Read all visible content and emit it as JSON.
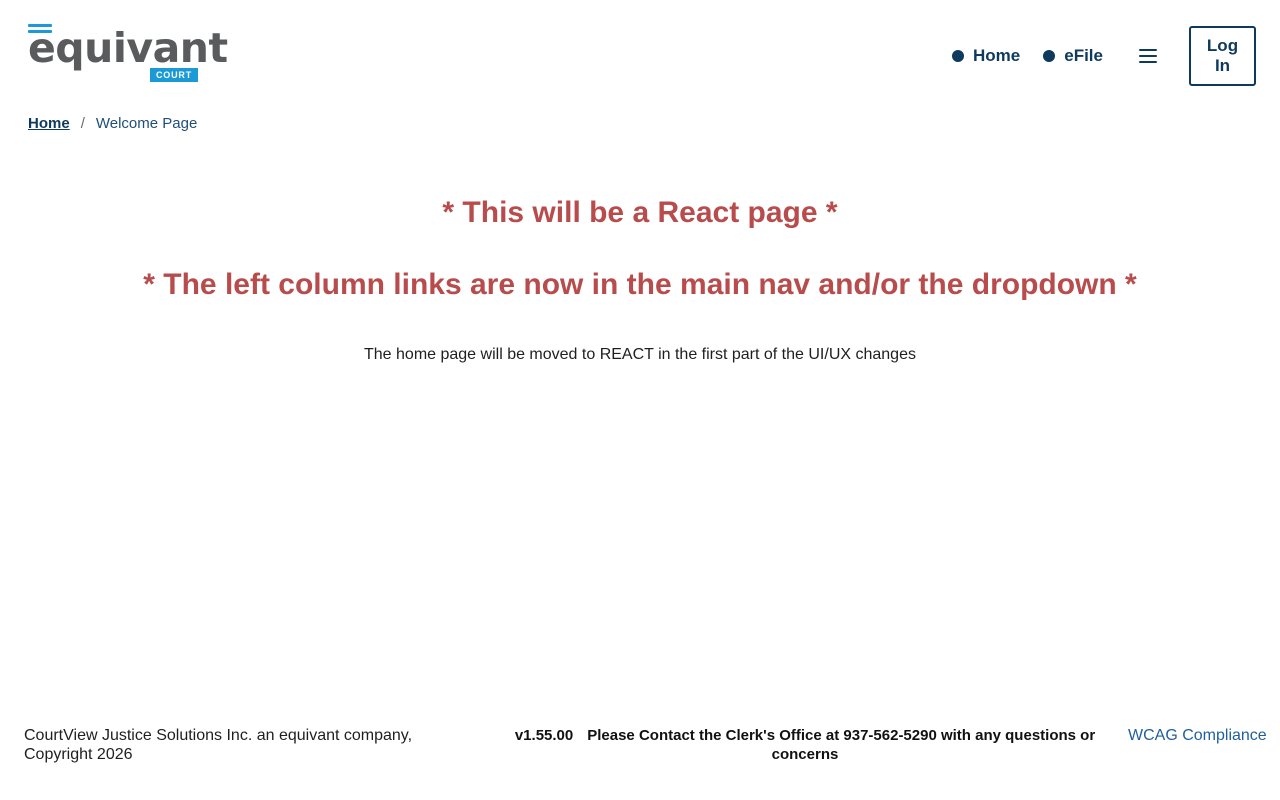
{
  "logo": {
    "wordmark": "equivant",
    "badge": "COURT",
    "accent": "#1b9ad6"
  },
  "nav": {
    "items": [
      {
        "label": "Home",
        "icon": "dot-icon"
      },
      {
        "label": "eFile",
        "icon": "dot-icon"
      }
    ],
    "menu_icon": "hamburger-icon",
    "login_label": "Log In"
  },
  "breadcrumb": {
    "home": "Home",
    "separator": "/",
    "current": "Welcome Page"
  },
  "main": {
    "heading1": "* This will be a React page *",
    "heading2": "* The left column links are now in the main nav and/or the dropdown *",
    "text": "The home page will be moved to REACT in the first part of the UI/UX changes"
  },
  "footer": {
    "company": "CourtView Justice Solutions Inc. an equivant company,",
    "copyright": "Copyright 2026",
    "version": "v1.55.00",
    "contact": "Please Contact the Clerk's Office at 937-562-5290 with any questions or concerns",
    "wcag": "WCAG Compliance"
  },
  "colors": {
    "primary": "#0e3a5d",
    "heading": "#b84c4c",
    "link": "#1f5f9e"
  }
}
